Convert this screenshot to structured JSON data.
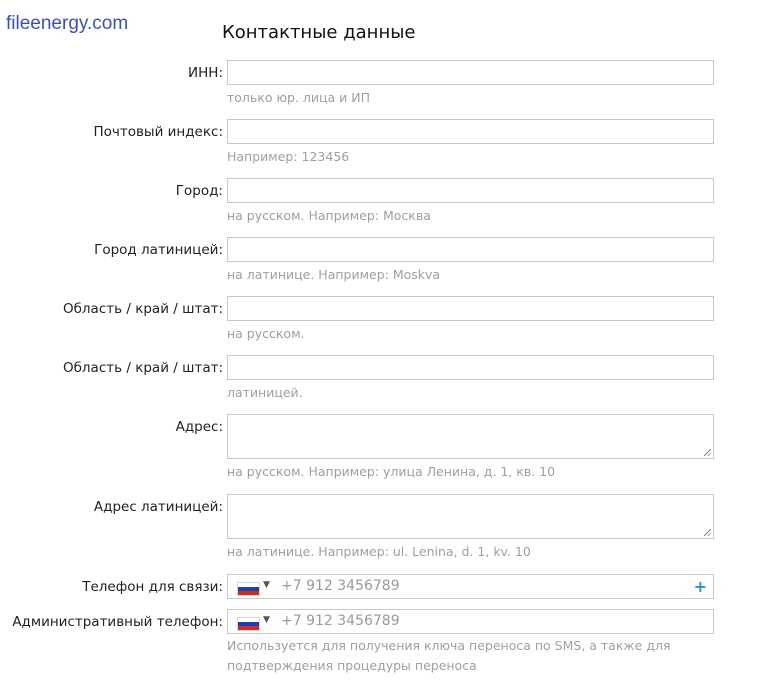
{
  "site": {
    "logo_text": "fileenergy.com"
  },
  "form": {
    "title": "Контактные данные",
    "fields": [
      {
        "label": "ИНН:",
        "value": "",
        "hint": "только юр. лица и ИП"
      },
      {
        "label": "Почтовый индекс:",
        "value": "",
        "hint": "Например: 123456"
      },
      {
        "label": "Город:",
        "value": "",
        "hint": "на русском. Например: Москва"
      },
      {
        "label": "Город латиницей:",
        "value": "",
        "hint": "на латинице. Например: Moskva"
      },
      {
        "label": "Область / край / штат:",
        "value": "",
        "hint": "на русском."
      },
      {
        "label": "Область / край / штат:",
        "value": "",
        "hint": "латиницей."
      },
      {
        "label": "Адрес:",
        "value": "",
        "hint": "на русском. Например: улица Ленина, д. 1, кв. 10"
      },
      {
        "label": "Адрес латиницей:",
        "value": "",
        "hint": "на латинице. Например: ul. Lenina, d. 1, kv. 10"
      }
    ],
    "phones": [
      {
        "label": "Телефон для связи:",
        "placeholder": "+7 912 3456789",
        "country_icon": "russia-flag-icon",
        "add_label": "+"
      },
      {
        "label": "Административный телефон:",
        "placeholder": "+7 912 3456789",
        "country_icon": "russia-flag-icon",
        "hint_line1": "Используется для получения ключа переноса по SMS, а также для",
        "hint_line2": "подтверждения процедуры переноса"
      }
    ]
  },
  "colors": {
    "logo": "#3b4fc4",
    "hint": "#9aa0a8",
    "accent": "#2d8fd8",
    "border": "#c9c9c9"
  }
}
